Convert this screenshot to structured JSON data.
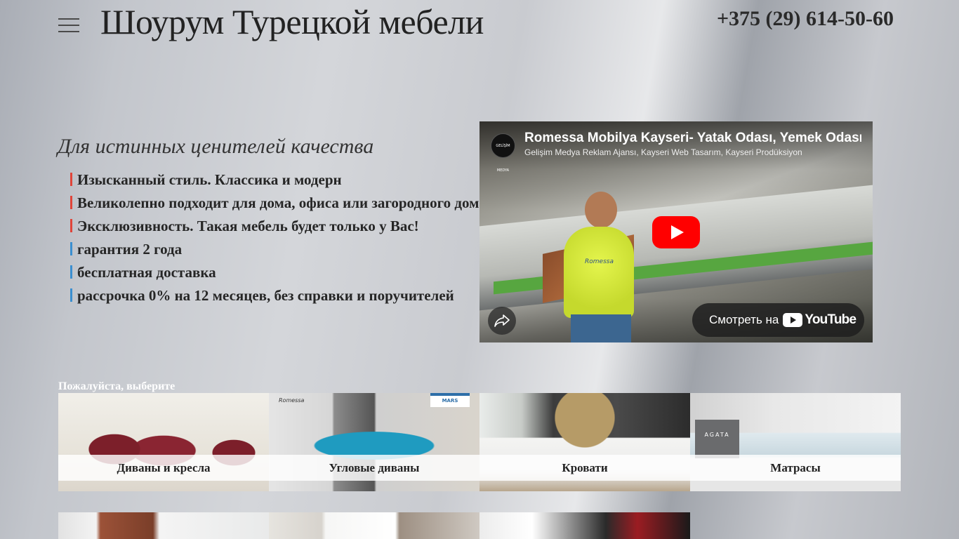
{
  "header": {
    "menu_icon": "hamburger-menu-icon",
    "title": "Шоурум Турецкой мебели",
    "phone": "+375 (29) 614-50-60"
  },
  "hero": {
    "tagline": "Для истинных ценителей качества",
    "features": [
      {
        "text": "Изысканный стиль. Классика и модерн",
        "marker_color": "#e0453a"
      },
      {
        "text": "Великолепно подходит для дома, офиса или загородного дома",
        "marker_color": "#e0453a"
      },
      {
        "text": "Эксклюзивность. Такая мебель будет только у Вас!",
        "marker_color": "#e0453a"
      },
      {
        "text": "гарантия 2 года",
        "marker_color": "#3b8fd0"
      },
      {
        "text": "бесплатная доставка",
        "marker_color": "#3b8fd0"
      },
      {
        "text": "рассрочка 0% на 12 месяцев, без справки и поручителей",
        "marker_color": "#3b8fd0"
      }
    ]
  },
  "video": {
    "title": "Romessa Mobilya Kayseri- Yatak Odası, Yemek Odası,",
    "channel": "Gelişim Medya Reklam Ajansı, Kayseri Web Tasarım, Kayseri Prodüksiyon",
    "channel_logo_text": "GELİŞİM MEDYA",
    "worker_shirt_text": "Romessa",
    "watch_label": "Смотреть на",
    "youtube_word": "YouTube",
    "play_color": "#ff0000"
  },
  "catalog": {
    "prompt": "Пожалуйста, выберите",
    "row1": [
      {
        "label": "Диваны и кресла"
      },
      {
        "label": "Угловые диваны",
        "brand": "Romessa",
        "tag": "MARS"
      },
      {
        "label": "Кровати"
      },
      {
        "label": "Матрасы",
        "brand": "AGATA"
      }
    ]
  }
}
